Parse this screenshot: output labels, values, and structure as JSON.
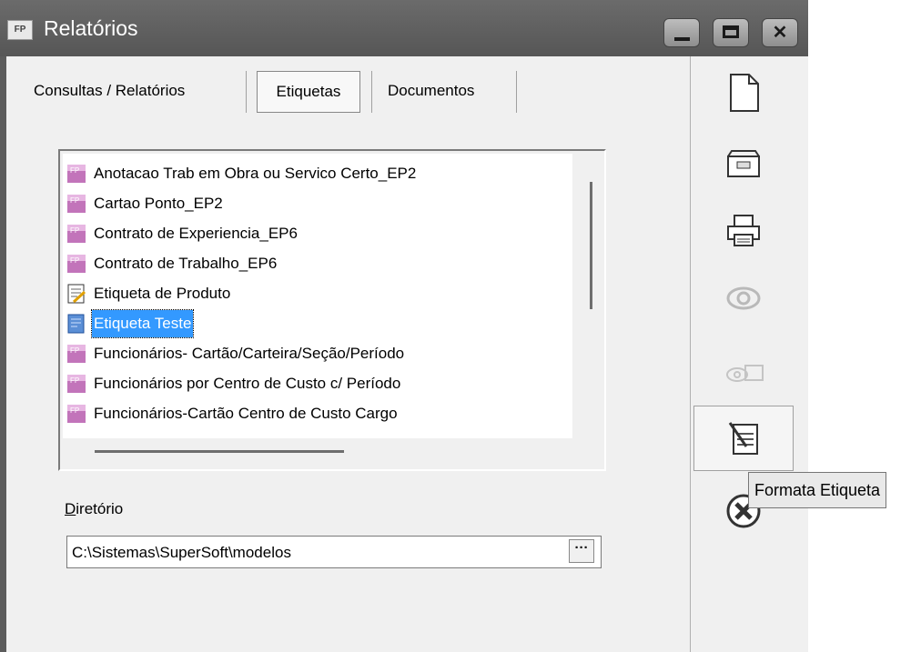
{
  "window": {
    "app_icon": "FP",
    "title": "Relatórios",
    "controls": [
      "minimize",
      "maximize",
      "close"
    ]
  },
  "tabs": [
    {
      "label": "Consultas / Relatórios",
      "active": false
    },
    {
      "label": "Etiquetas",
      "active": true
    },
    {
      "label": "Documentos",
      "active": false
    }
  ],
  "list": {
    "items": [
      {
        "label": "Anotacao Trab em Obra ou Servico Certo_EP2",
        "icon": "report-icon"
      },
      {
        "label": "Cartao Ponto_EP2",
        "icon": "report-icon"
      },
      {
        "label": "Contrato de Experiencia_EP6",
        "icon": "report-icon"
      },
      {
        "label": "Contrato de Trabalho_EP6",
        "icon": "report-icon"
      },
      {
        "label": "Etiqueta de Produto",
        "icon": "label-edit-icon"
      },
      {
        "label": "Etiqueta Teste",
        "icon": "label-blue-icon",
        "selected": true
      },
      {
        "label": "Funcionários- Cartão/Carteira/Seção/Período",
        "icon": "report-icon"
      },
      {
        "label": "Funcionários por Centro de Custo  c/ Período",
        "icon": "report-icon"
      },
      {
        "label": "Funcionários-Cartão Centro de Custo Cargo",
        "icon": "report-icon"
      }
    ]
  },
  "directory": {
    "label_accel": "D",
    "label_rest": "iretório",
    "value": "C:\\Sistemas\\SuperSoft\\modelos",
    "browse_label": "···"
  },
  "toolbar": {
    "tools": [
      "new-document-icon",
      "open-folder-icon",
      "printer-icon",
      "preview-eye-icon",
      "eye-folder-icon",
      "format-label-icon",
      "close-circle-icon"
    ],
    "tooltip": "Formata Etiqueta"
  },
  "colors": {
    "titlebar": "#5e5e5e",
    "selection": "#3399ff",
    "report_icon": "#b05aa8"
  }
}
